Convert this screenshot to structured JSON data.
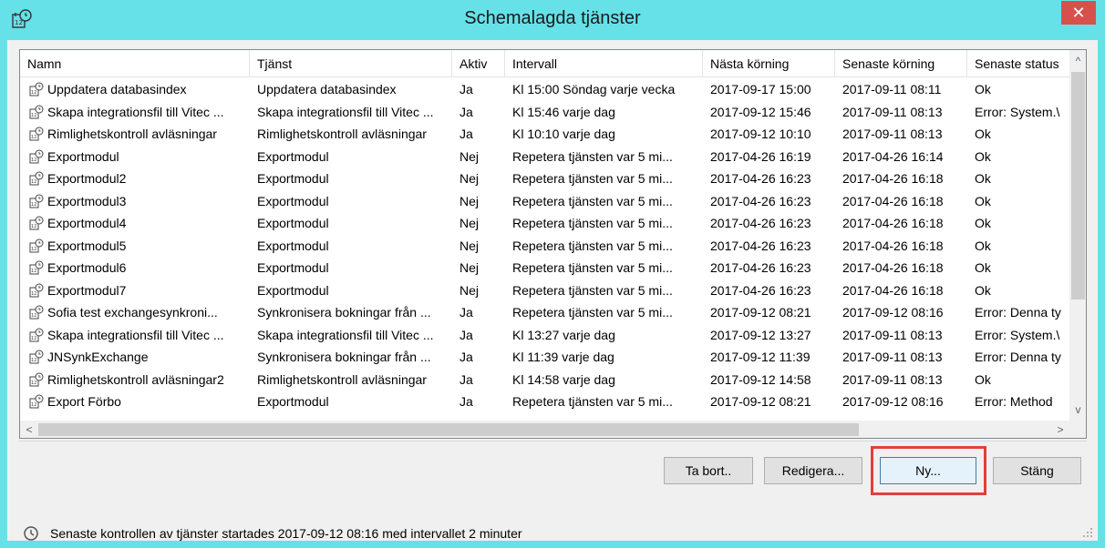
{
  "window": {
    "title": "Schemalagda tjänster",
    "close_label": "✕"
  },
  "columns": [
    "Namn",
    "Tjänst",
    "Aktiv",
    "Intervall",
    "Nästa körning",
    "Senaste körning",
    "Senaste status"
  ],
  "rows": [
    [
      "Uppdatera databasindex",
      "Uppdatera databasindex",
      "Ja",
      "Kl 15:00 Söndag varje vecka",
      "2017-09-17 15:00",
      "2017-09-11 08:11",
      "Ok"
    ],
    [
      "Skapa integrationsfil till Vitec ...",
      "Skapa integrationsfil till Vitec ...",
      "Ja",
      "Kl 15:46 varje dag",
      "2017-09-12 15:46",
      "2017-09-11 08:13",
      "Error: System.\\"
    ],
    [
      "Rimlighetskontroll avläsningar",
      "Rimlighetskontroll avläsningar",
      "Ja",
      "Kl 10:10 varje dag",
      "2017-09-12 10:10",
      "2017-09-11 08:13",
      "Ok"
    ],
    [
      "Exportmodul",
      "Exportmodul",
      "Nej",
      "Repetera tjänsten var 5 mi...",
      "2017-04-26 16:19",
      "2017-04-26 16:14",
      "Ok"
    ],
    [
      "Exportmodul2",
      "Exportmodul",
      "Nej",
      "Repetera tjänsten var 5 mi...",
      "2017-04-26 16:23",
      "2017-04-26 16:18",
      "Ok"
    ],
    [
      "Exportmodul3",
      "Exportmodul",
      "Nej",
      "Repetera tjänsten var 5 mi...",
      "2017-04-26 16:23",
      "2017-04-26 16:18",
      "Ok"
    ],
    [
      "Exportmodul4",
      "Exportmodul",
      "Nej",
      "Repetera tjänsten var 5 mi...",
      "2017-04-26 16:23",
      "2017-04-26 16:18",
      "Ok"
    ],
    [
      "Exportmodul5",
      "Exportmodul",
      "Nej",
      "Repetera tjänsten var 5 mi...",
      "2017-04-26 16:23",
      "2017-04-26 16:18",
      "Ok"
    ],
    [
      "Exportmodul6",
      "Exportmodul",
      "Nej",
      "Repetera tjänsten var 5 mi...",
      "2017-04-26 16:23",
      "2017-04-26 16:18",
      "Ok"
    ],
    [
      "Exportmodul7",
      "Exportmodul",
      "Nej",
      "Repetera tjänsten var 5 mi...",
      "2017-04-26 16:23",
      "2017-04-26 16:18",
      "Ok"
    ],
    [
      "Sofia test exchangesynkroni...",
      "Synkronisera bokningar från ...",
      "Ja",
      "Repetera tjänsten var 5 mi...",
      "2017-09-12 08:21",
      "2017-09-12 08:16",
      "Error: Denna ty"
    ],
    [
      "Skapa integrationsfil till Vitec ...",
      "Skapa integrationsfil till Vitec ...",
      "Ja",
      "Kl 13:27 varje dag",
      "2017-09-12 13:27",
      "2017-09-11 08:13",
      "Error: System.\\"
    ],
    [
      "JNSynkExchange",
      "Synkronisera bokningar från ...",
      "Ja",
      "Kl 11:39 varje dag",
      "2017-09-12 11:39",
      "2017-09-11 08:13",
      "Error: Denna ty"
    ],
    [
      "Rimlighetskontroll avläsningar2",
      "Rimlighetskontroll avläsningar",
      "Ja",
      "Kl 14:58 varje dag",
      "2017-09-12 14:58",
      "2017-09-11 08:13",
      "Ok"
    ],
    [
      "Export Förbo",
      "Exportmodul",
      "Ja",
      "Repetera tjänsten var 5 mi...",
      "2017-09-12 08:21",
      "2017-09-12 08:16",
      "Error: Method"
    ]
  ],
  "buttons": {
    "delete": "Ta bort..",
    "edit": "Redigera...",
    "new": "Ny...",
    "close": "Stäng"
  },
  "status_text": "Senaste kontrollen av tjänster startades 2017-09-12 08:16 med intervallet 2 minuter",
  "colors": {
    "titlebar": "#66e1e8",
    "close": "#d6514b",
    "highlight": "#e0403a"
  }
}
